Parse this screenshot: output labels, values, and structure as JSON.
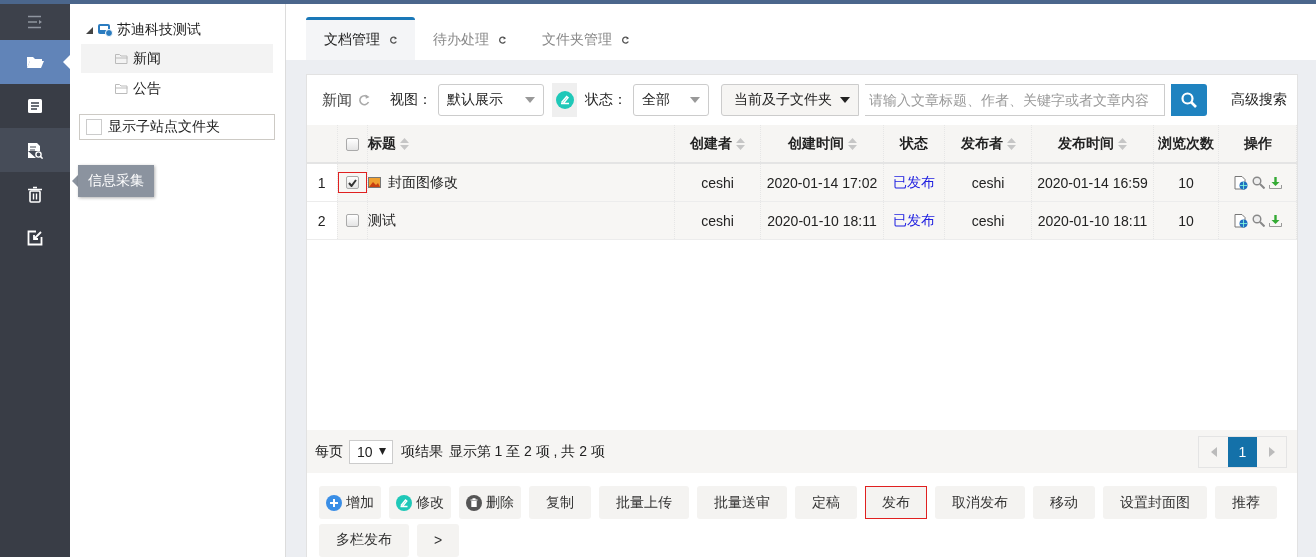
{
  "sidebar": {
    "items": [
      {
        "kind": "menu",
        "selected": false,
        "hovered": false
      },
      {
        "kind": "folder",
        "selected": true,
        "hovered": false
      },
      {
        "kind": "document",
        "selected": false,
        "hovered": false
      },
      {
        "kind": "search-document",
        "selected": false,
        "hovered": true
      },
      {
        "kind": "trash",
        "selected": false,
        "hovered": false
      },
      {
        "kind": "export",
        "selected": false,
        "hovered": false
      }
    ],
    "tooltip": "信息采集"
  },
  "tree": {
    "label": "苏迪科技测试",
    "expanded": true,
    "children": [
      {
        "label": "新闻",
        "selected": true
      },
      {
        "label": "公告",
        "selected": false
      }
    ]
  },
  "show_subsite_folders": {
    "label": "显示子站点文件夹",
    "checked": false
  },
  "tabs": [
    {
      "label": "文档管理",
      "selected": true
    },
    {
      "label": "待办处理",
      "selected": false
    },
    {
      "label": "文件夹管理",
      "selected": false
    }
  ],
  "toolbar": {
    "folder": "新闻",
    "view_label": "视图：",
    "view": "默认展示",
    "status_label": "状态：",
    "status": "全部",
    "scope": "当前及子文件夹",
    "search_placeholder": "请输入文章标题、作者、关键字或者文章内容",
    "advanced_search": "高级搜索"
  },
  "table": {
    "columns": [
      {
        "label": "标题",
        "sortable": true
      },
      {
        "label": "创建者",
        "sortable": true
      },
      {
        "label": "创建时间",
        "sortable": true
      },
      {
        "label": "状态",
        "sortable": false
      },
      {
        "label": "发布者",
        "sortable": true
      },
      {
        "label": "发布时间",
        "sortable": true
      },
      {
        "label": "浏览次数",
        "sortable": false
      },
      {
        "label": "操作",
        "sortable": false
      }
    ],
    "all_checked": false,
    "rows": [
      {
        "index": "1",
        "checked": true,
        "highlighted": true,
        "has_cover": true,
        "title": "封面图修改",
        "creator": "ceshi",
        "created": "2020-01-14 17:02",
        "status": "已发布",
        "publisher": "ceshi",
        "published": "2020-01-14 16:59",
        "views": "10"
      },
      {
        "index": "2",
        "checked": false,
        "highlighted": false,
        "has_cover": false,
        "title": "测试",
        "creator": "ceshi",
        "created": "2020-01-10 18:11",
        "status": "已发布",
        "publisher": "ceshi",
        "published": "2020-01-10 18:11",
        "views": "10"
      }
    ]
  },
  "pagination": {
    "per_page_label": "每页",
    "per_page": "10",
    "results_label": "项结果",
    "summary": "显示第 1 至 2 项 , 共 2 项",
    "pages": [
      {
        "label": "1",
        "selected": true
      }
    ]
  },
  "actions": [
    {
      "label": "增加",
      "kind": "add",
      "highlighted": false
    },
    {
      "label": "修改",
      "kind": "edit",
      "highlighted": false
    },
    {
      "label": "删除",
      "kind": "delete",
      "highlighted": false
    },
    {
      "label": "复制",
      "kind": "plain",
      "highlighted": false
    },
    {
      "label": "批量上传",
      "kind": "plain",
      "highlighted": false
    },
    {
      "label": "批量送审",
      "kind": "plain",
      "highlighted": false
    },
    {
      "label": "定稿",
      "kind": "plain",
      "highlighted": false
    },
    {
      "label": "发布",
      "kind": "plain",
      "highlighted": true
    },
    {
      "label": "取消发布",
      "kind": "plain",
      "highlighted": false
    },
    {
      "label": "移动",
      "kind": "plain",
      "highlighted": false
    },
    {
      "label": "设置封面图",
      "kind": "plain",
      "highlighted": false
    },
    {
      "label": "推荐",
      "kind": "plain",
      "highlighted": false
    },
    {
      "label": "多栏发布",
      "kind": "plain",
      "highlighted": false
    },
    {
      "label": ">",
      "kind": "plain",
      "highlighted": false
    }
  ]
}
